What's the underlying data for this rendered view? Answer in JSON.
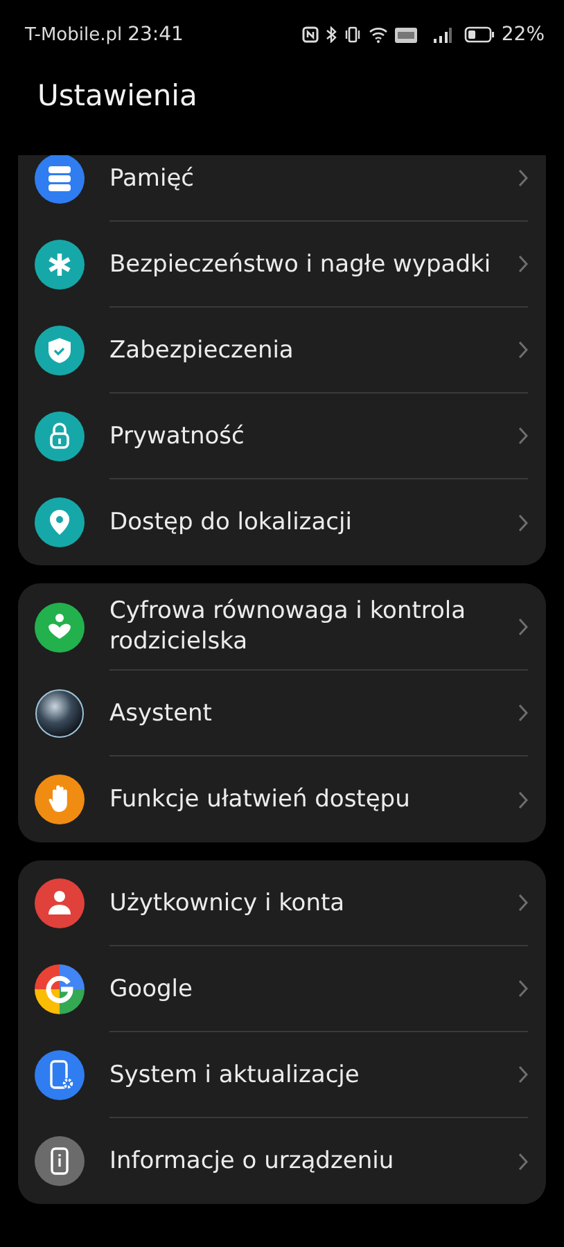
{
  "status_bar": {
    "carrier": "T-Mobile.pl",
    "time": "23:41",
    "battery": "22%"
  },
  "title": "Ustawienia",
  "groups": [
    {
      "items": [
        {
          "label": "Pamięć",
          "kind": "storage",
          "color": "#2f7df0"
        },
        {
          "label": "Bezpieczeństwo i nagłe wypadki",
          "kind": "asterisk",
          "color": "#16a8a8"
        },
        {
          "label": "Zabezpieczenia",
          "kind": "shield",
          "color": "#16a8a8"
        },
        {
          "label": "Prywatność",
          "kind": "lock",
          "color": "#16a8a8"
        },
        {
          "label": "Dostęp do lokalizacji",
          "kind": "pin",
          "color": "#16a8a8"
        }
      ]
    },
    {
      "items": [
        {
          "label": "Cyfrowa równowaga i kontrola rodzicielska",
          "kind": "wellbeing",
          "color": "#23b14d"
        },
        {
          "label": "Asystent",
          "kind": "sphere",
          "color": "#3a4a5a"
        },
        {
          "label": "Funkcje ułatwień dostępu",
          "kind": "hand",
          "color": "#f08c12"
        }
      ]
    },
    {
      "items": [
        {
          "label": "Użytkownicy i konta",
          "kind": "person",
          "color": "#e0413b"
        },
        {
          "label": "Google",
          "kind": "google",
          "color": "#4285f4"
        },
        {
          "label": "System i aktualizacje",
          "kind": "phonegear",
          "color": "#2f7df0"
        },
        {
          "label": "Informacje o urządzeniu",
          "kind": "phoneinfo",
          "color": "#6b6b6b"
        }
      ]
    }
  ]
}
